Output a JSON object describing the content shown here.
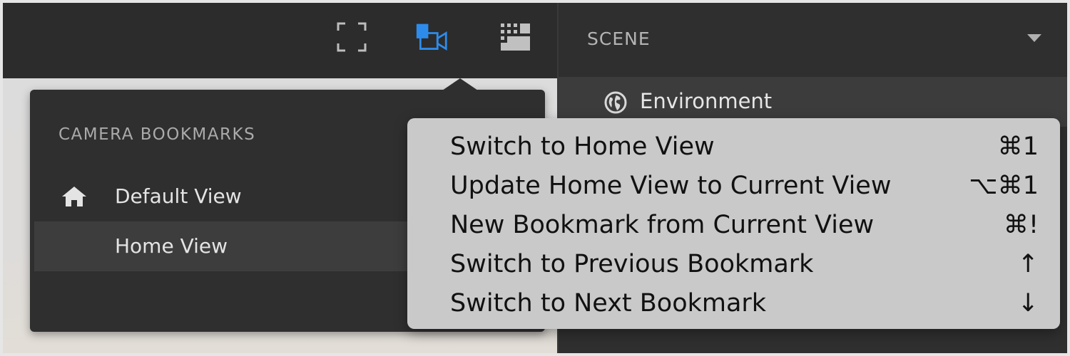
{
  "toolbar": {
    "icons": [
      "fullscreen-icon",
      "camera-bookmarks-icon",
      "grid-icon"
    ],
    "active_color": "#2d8ceb"
  },
  "scene": {
    "title": "SCENE",
    "items": [
      {
        "label": "Environment",
        "icon": "globe-icon"
      }
    ]
  },
  "bookmarks": {
    "title": "CAMERA BOOKMARKS",
    "items": [
      {
        "label": "Default View",
        "icon": "home-icon"
      },
      {
        "label": "Home View",
        "selected": true
      }
    ]
  },
  "context_menu": {
    "items": [
      {
        "label": "Switch to Home View",
        "shortcut": "⌘1"
      },
      {
        "label": "Update Home View to Current View",
        "shortcut": "⌥⌘1"
      },
      {
        "label": "New Bookmark from Current View",
        "shortcut": "⌘!"
      },
      {
        "label": "Switch to Previous Bookmark",
        "shortcut": "↑"
      },
      {
        "label": "Switch to Next Bookmark",
        "shortcut": "↓"
      }
    ]
  }
}
